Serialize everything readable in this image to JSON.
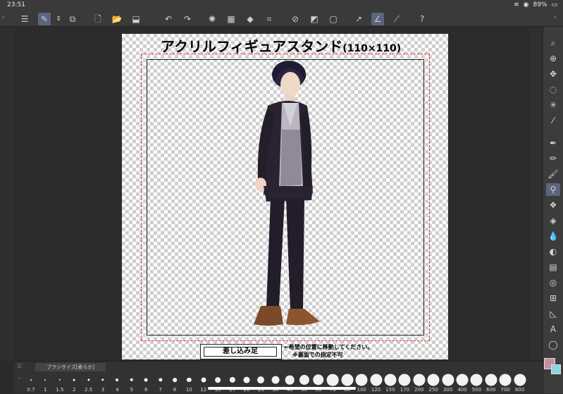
{
  "status": {
    "time": "23:51",
    "battery": "89%"
  },
  "toolbar": {
    "icons": [
      "menu-icon",
      "brush-settings-icon",
      "stepper-icon",
      "reference-icon",
      "new-file-icon",
      "open-folder-icon",
      "save-icon",
      "undo-icon",
      "redo-icon",
      "transform-icon",
      "fill-icon",
      "selection-icon",
      "crop-icon",
      "clear-icon",
      "mask-icon",
      "frame-icon",
      "tool-1-icon",
      "tool-2-icon",
      "tool-3-icon",
      "help-icon"
    ]
  },
  "canvas": {
    "title_main": "アクリルフィギュアスタンド",
    "title_suffix": "(110×110)",
    "insert_label": "差し込み足",
    "note_line1": "←希望の位置に移動してください。",
    "note_line2": "※裏面での指定不可",
    "colors": {
      "dashed": "#e33333",
      "frame": "#222222"
    }
  },
  "brush_panel": {
    "tab_label": "ブラシサイズ[柔らか]",
    "sizes": [
      "0.7",
      "1",
      "1.5",
      "2",
      "2.5",
      "3",
      "4",
      "5",
      "6",
      "7",
      "8",
      "10",
      "12",
      "15",
      "17",
      "20",
      "25",
      "30",
      "40",
      "50",
      "60",
      "70",
      "80",
      "100",
      "120",
      "150",
      "170",
      "200",
      "250",
      "300",
      "400",
      "500",
      "600",
      "700",
      "800"
    ]
  },
  "color": {
    "main": "#c48f9d",
    "sub": "#8fd3e0"
  }
}
